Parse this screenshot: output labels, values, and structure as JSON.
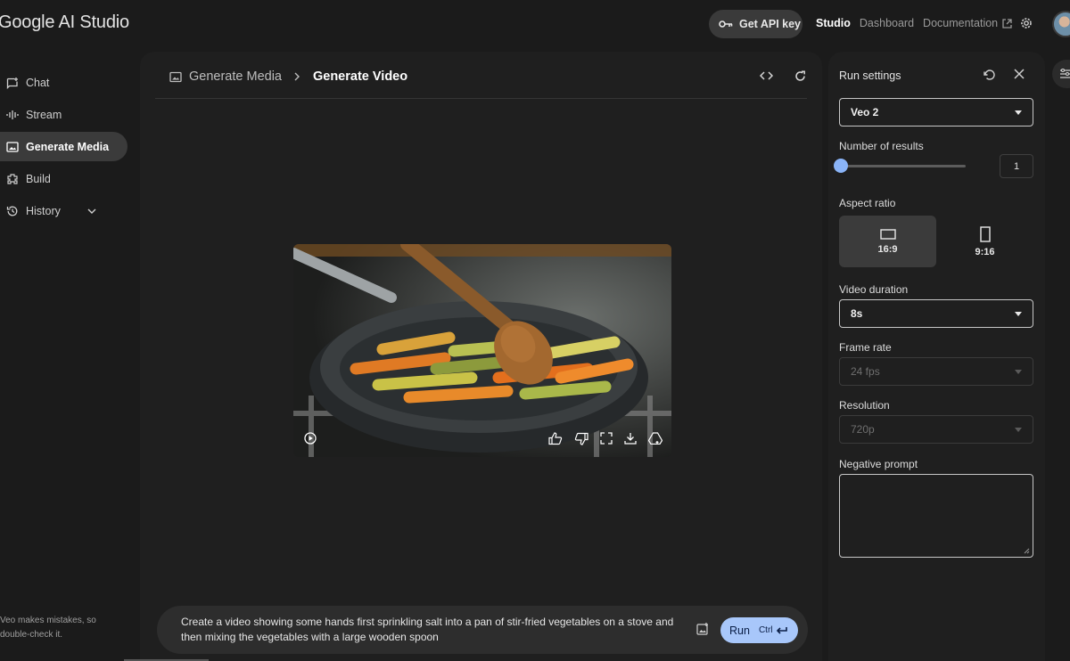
{
  "app": {
    "title": "Google AI Studio"
  },
  "topbar": {
    "api_key_label": "Get API key",
    "nav": {
      "studio": "Studio",
      "dashboard": "Dashboard",
      "documentation": "Documentation"
    }
  },
  "sidebar": {
    "items": [
      {
        "label": "Chat",
        "icon": "chat-icon"
      },
      {
        "label": "Stream",
        "icon": "waveform-icon"
      },
      {
        "label": "Generate Media",
        "icon": "image-icon",
        "active": true
      },
      {
        "label": "Build",
        "icon": "build-icon"
      },
      {
        "label": "History",
        "icon": "history-icon"
      }
    ],
    "disclaimer": "Veo makes mistakes, so double-check it."
  },
  "main": {
    "breadcrumb": {
      "parent": "Generate Media",
      "current": "Generate Video"
    },
    "prompt": "Create a video showing some hands first sprinkling salt into a pan of stir-fried vegetables on a stove and then mixing the vegetables with a large wooden spoon",
    "run_label": "Run",
    "run_shortcut": "Ctrl"
  },
  "settings": {
    "title": "Run settings",
    "model": "Veo 2",
    "number_of_results": {
      "label": "Number of results",
      "value": "1"
    },
    "aspect_ratio": {
      "label": "Aspect ratio",
      "options": [
        "16:9",
        "9:16"
      ],
      "selected": "16:9"
    },
    "video_duration": {
      "label": "Video duration",
      "value": "8s"
    },
    "frame_rate": {
      "label": "Frame rate",
      "value": "24 fps"
    },
    "resolution": {
      "label": "Resolution",
      "value": "720p"
    },
    "negative_prompt": {
      "label": "Negative prompt",
      "value": ""
    }
  },
  "colors": {
    "accent": "#a8c7fa",
    "slider": "#8ab4f8",
    "background": "#1b1b1b",
    "panel": "#1f1f1f"
  }
}
